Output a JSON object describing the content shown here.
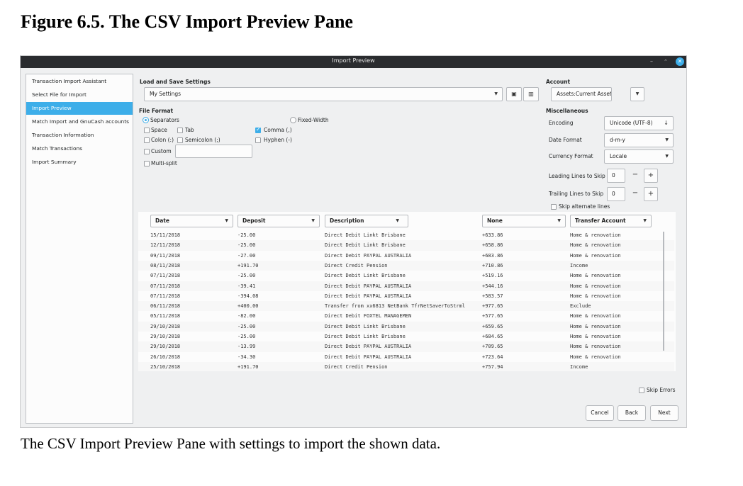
{
  "figure": {
    "title": "Figure 6.5. The CSV Import Preview Pane",
    "caption": "The CSV Import Preview Pane with settings to import the shown data."
  },
  "window": {
    "title": "Import Preview"
  },
  "sidebar": {
    "items": [
      {
        "label": "Transaction Import Assistant",
        "active": false
      },
      {
        "label": "Select File for Import",
        "active": false
      },
      {
        "label": "Import Preview",
        "active": true
      },
      {
        "label": "Match Import and GnuCash accounts",
        "active": false
      },
      {
        "label": "Transaction Information",
        "active": false
      },
      {
        "label": "Match Transactions",
        "active": false
      },
      {
        "label": "Import Summary",
        "active": false
      }
    ]
  },
  "settings": {
    "heading": "Load and Save Settings",
    "selected": "My Settings",
    "save_icon": "save-icon",
    "delete_icon": "trash-icon"
  },
  "account": {
    "heading": "Account",
    "value": "Assets:Current Assets:Savi"
  },
  "file_format": {
    "heading": "File Format",
    "mode_separators": "Separators",
    "mode_fixed_width": "Fixed-Width",
    "selected_mode": "Separators",
    "space": "Space",
    "tab": "Tab",
    "comma": "Comma (,)",
    "colon": "Colon (:)",
    "semicolon": "Semicolon (;)",
    "hyphen": "Hyphen (-)",
    "custom": "Custom",
    "custom_value": "",
    "multi_split": "Multi-split",
    "comma_checked": true
  },
  "misc": {
    "heading": "Miscellaneous",
    "encoding_label": "Encoding",
    "encoding_value": "Unicode (UTF-8)",
    "date_format_label": "Date Format",
    "date_format_value": "d-m-y",
    "currency_format_label": "Currency Format",
    "currency_format_value": "Locale",
    "leading_label": "Leading Lines to Skip",
    "leading_value": "0",
    "trailing_label": "Trailing Lines to Skip",
    "trailing_value": "0",
    "skip_alternate": "Skip alternate lines",
    "minus": "−",
    "plus": "+"
  },
  "table": {
    "columns": [
      "Date",
      "Deposit",
      "Description",
      "None",
      "Transfer Account"
    ],
    "rows": [
      [
        "15/11/2018",
        "-25.00",
        "Direct Debit  Linkt Brisbane",
        "+633.86",
        "Home & renovation"
      ],
      [
        "12/11/2018",
        "-25.00",
        "Direct Debit  Linkt Brisbane",
        "+658.86",
        "Home & renovation"
      ],
      [
        "09/11/2018",
        "-27.00",
        "Direct Debit  PAYPAL AUSTRALIA",
        "+683.86",
        "Home & renovation"
      ],
      [
        "08/11/2018",
        "+191.70",
        "Direct Credit Pension",
        "+710.86",
        "Income"
      ],
      [
        "07/11/2018",
        "-25.00",
        "Direct Debit  Linkt Brisbane",
        "+519.16",
        "Home & renovation"
      ],
      [
        "07/11/2018",
        "-39.41",
        "Direct Debit  PAYPAL AUSTRALIA",
        "+544.16",
        "Home & renovation"
      ],
      [
        "07/11/2018",
        "-394.08",
        "Direct Debit PAYPAL AUSTRALIA",
        "+583.57",
        "Home & renovation"
      ],
      [
        "06/11/2018",
        "+400.00",
        "Transfer from xx6813 NetBank TfrNetSaverToStrml",
        "+977.65",
        "Exclude"
      ],
      [
        "05/11/2018",
        "-82.00",
        "Direct Debit  FOXTEL MANAGEMEN",
        "+577.65",
        "Home & renovation"
      ],
      [
        "29/10/2018",
        "-25.00",
        "Direct Debit Linkt Brisbane",
        "+659.65",
        "Home & renovation"
      ],
      [
        "29/10/2018",
        "-25.00",
        "Direct Debit Linkt Brisbane",
        "+684.65",
        "Home & renovation"
      ],
      [
        "29/10/2018",
        "-13.99",
        "Direct Debit PAYPAL AUSTRALIA",
        "+709.65",
        "Home & renovation"
      ],
      [
        "26/10/2018",
        "-34.30",
        "Direct Debit  PAYPAL AUSTRALIA",
        "+723.64",
        "Home & renovation"
      ],
      [
        "25/10/2018",
        "+191.70",
        "Direct Credit Pension",
        "+757.94",
        "Income"
      ]
    ]
  },
  "footer": {
    "skip_errors": "Skip Errors",
    "cancel": "Cancel",
    "back": "Back",
    "next": "Next"
  },
  "colors": {
    "accent": "#3daee9",
    "titlebar": "#2a2c2f"
  }
}
